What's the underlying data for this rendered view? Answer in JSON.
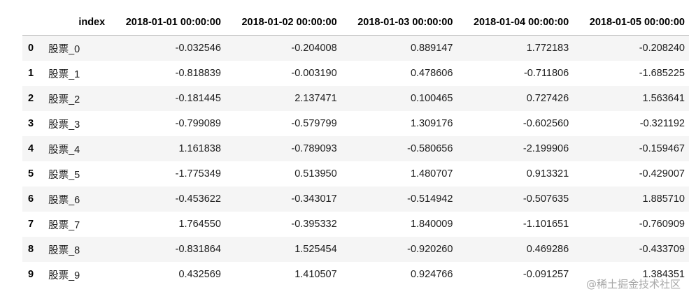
{
  "table": {
    "columns": [
      "index",
      "2018-01-01 00:00:00",
      "2018-01-02 00:00:00",
      "2018-01-03 00:00:00",
      "2018-01-04 00:00:00",
      "2018-01-05 00:00:00"
    ],
    "rows": [
      {
        "idx": "0",
        "cells": [
          "股票_0",
          "-0.032546",
          "-0.204008",
          "0.889147",
          "1.772183",
          "-0.208240"
        ]
      },
      {
        "idx": "1",
        "cells": [
          "股票_1",
          "-0.818839",
          "-0.003190",
          "0.478606",
          "-0.711806",
          "-1.685225"
        ]
      },
      {
        "idx": "2",
        "cells": [
          "股票_2",
          "-0.181445",
          "2.137471",
          "0.100465",
          "0.727426",
          "1.563641"
        ]
      },
      {
        "idx": "3",
        "cells": [
          "股票_3",
          "-0.799089",
          "-0.579799",
          "1.309176",
          "-0.602560",
          "-0.321192"
        ]
      },
      {
        "idx": "4",
        "cells": [
          "股票_4",
          "1.161838",
          "-0.789093",
          "-0.580656",
          "-2.199906",
          "-0.159467"
        ]
      },
      {
        "idx": "5",
        "cells": [
          "股票_5",
          "-1.775349",
          "0.513950",
          "1.480707",
          "0.913321",
          "-0.429007"
        ]
      },
      {
        "idx": "6",
        "cells": [
          "股票_6",
          "-0.453622",
          "-0.343017",
          "-0.514942",
          "-0.507635",
          "1.885710"
        ]
      },
      {
        "idx": "7",
        "cells": [
          "股票_7",
          "1.764550",
          "-0.395332",
          "1.840009",
          "-1.101651",
          "-0.760909"
        ]
      },
      {
        "idx": "8",
        "cells": [
          "股票_8",
          "-0.831864",
          "1.525454",
          "-0.920260",
          "0.469286",
          "-0.433709"
        ]
      },
      {
        "idx": "9",
        "cells": [
          "股票_9",
          "0.432569",
          "1.410507",
          "0.924766",
          "-0.091257",
          "1.384351"
        ]
      }
    ]
  },
  "watermark": "@稀土掘金技术社区"
}
